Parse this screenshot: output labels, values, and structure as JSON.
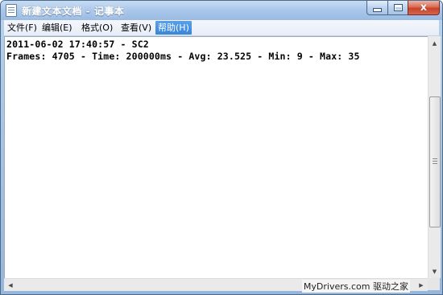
{
  "window": {
    "title": "新建文本文档 - 记事本",
    "controls": {
      "minimize": "",
      "maximize": "",
      "close": "x"
    }
  },
  "menu": {
    "items": [
      {
        "label": "文件(F)"
      },
      {
        "label": "编辑(E)"
      },
      {
        "label": "格式(O)"
      },
      {
        "label": "查看(V)"
      },
      {
        "label": "帮助(H)",
        "active": true
      }
    ]
  },
  "document": {
    "lines": [
      "2011-06-02 17:40:57 - SC2",
      "Frames: 4705 - Time: 200000ms - Avg: 23.525 - Min: 9 - Max: 35"
    ]
  },
  "scrollbars": {
    "vertical": {
      "up": "▲",
      "down": "▼"
    },
    "horizontal": {
      "left": "◀",
      "right": "▶"
    }
  },
  "watermark": "MyDrivers.com 驱动之家",
  "colors": {
    "title_bar": "#a8c6ea",
    "close_button": "#c9422a",
    "menu_highlight": "#3886d8",
    "text": "#000000"
  }
}
